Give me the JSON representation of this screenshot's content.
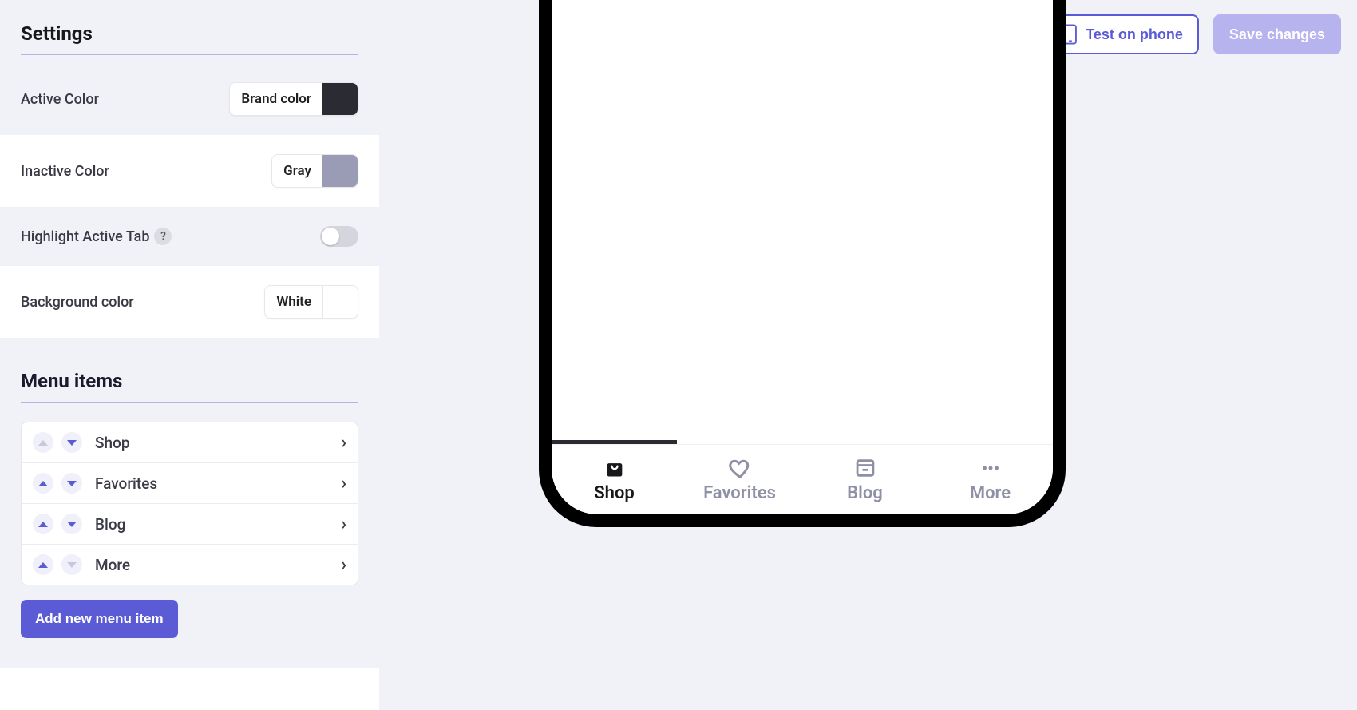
{
  "sidebar": {
    "settings_title": "Settings",
    "active_color_label": "Active Color",
    "active_color_value": "Brand color",
    "inactive_color_label": "Inactive Color",
    "inactive_color_value": "Gray",
    "highlight_label": "Highlight Active Tab",
    "background_label": "Background color",
    "background_value": "White",
    "menu_title": "Menu items",
    "menu_items": [
      {
        "label": "Shop"
      },
      {
        "label": "Favorites"
      },
      {
        "label": "Blog"
      },
      {
        "label": "More"
      }
    ],
    "add_button": "Add new menu item"
  },
  "actions": {
    "test": "Test on phone",
    "save": "Save changes"
  },
  "tabbar": {
    "items": [
      {
        "label": "Shop",
        "icon": "bag-icon",
        "active": true
      },
      {
        "label": "Favorites",
        "icon": "heart-icon",
        "active": false
      },
      {
        "label": "Blog",
        "icon": "archive-icon",
        "active": false
      },
      {
        "label": "More",
        "icon": "dots-icon",
        "active": false
      }
    ]
  },
  "colors": {
    "brand": "#2b2b33",
    "gray": "#9a9bb5",
    "white": "#ffffff",
    "accent": "#5b5bd6"
  }
}
